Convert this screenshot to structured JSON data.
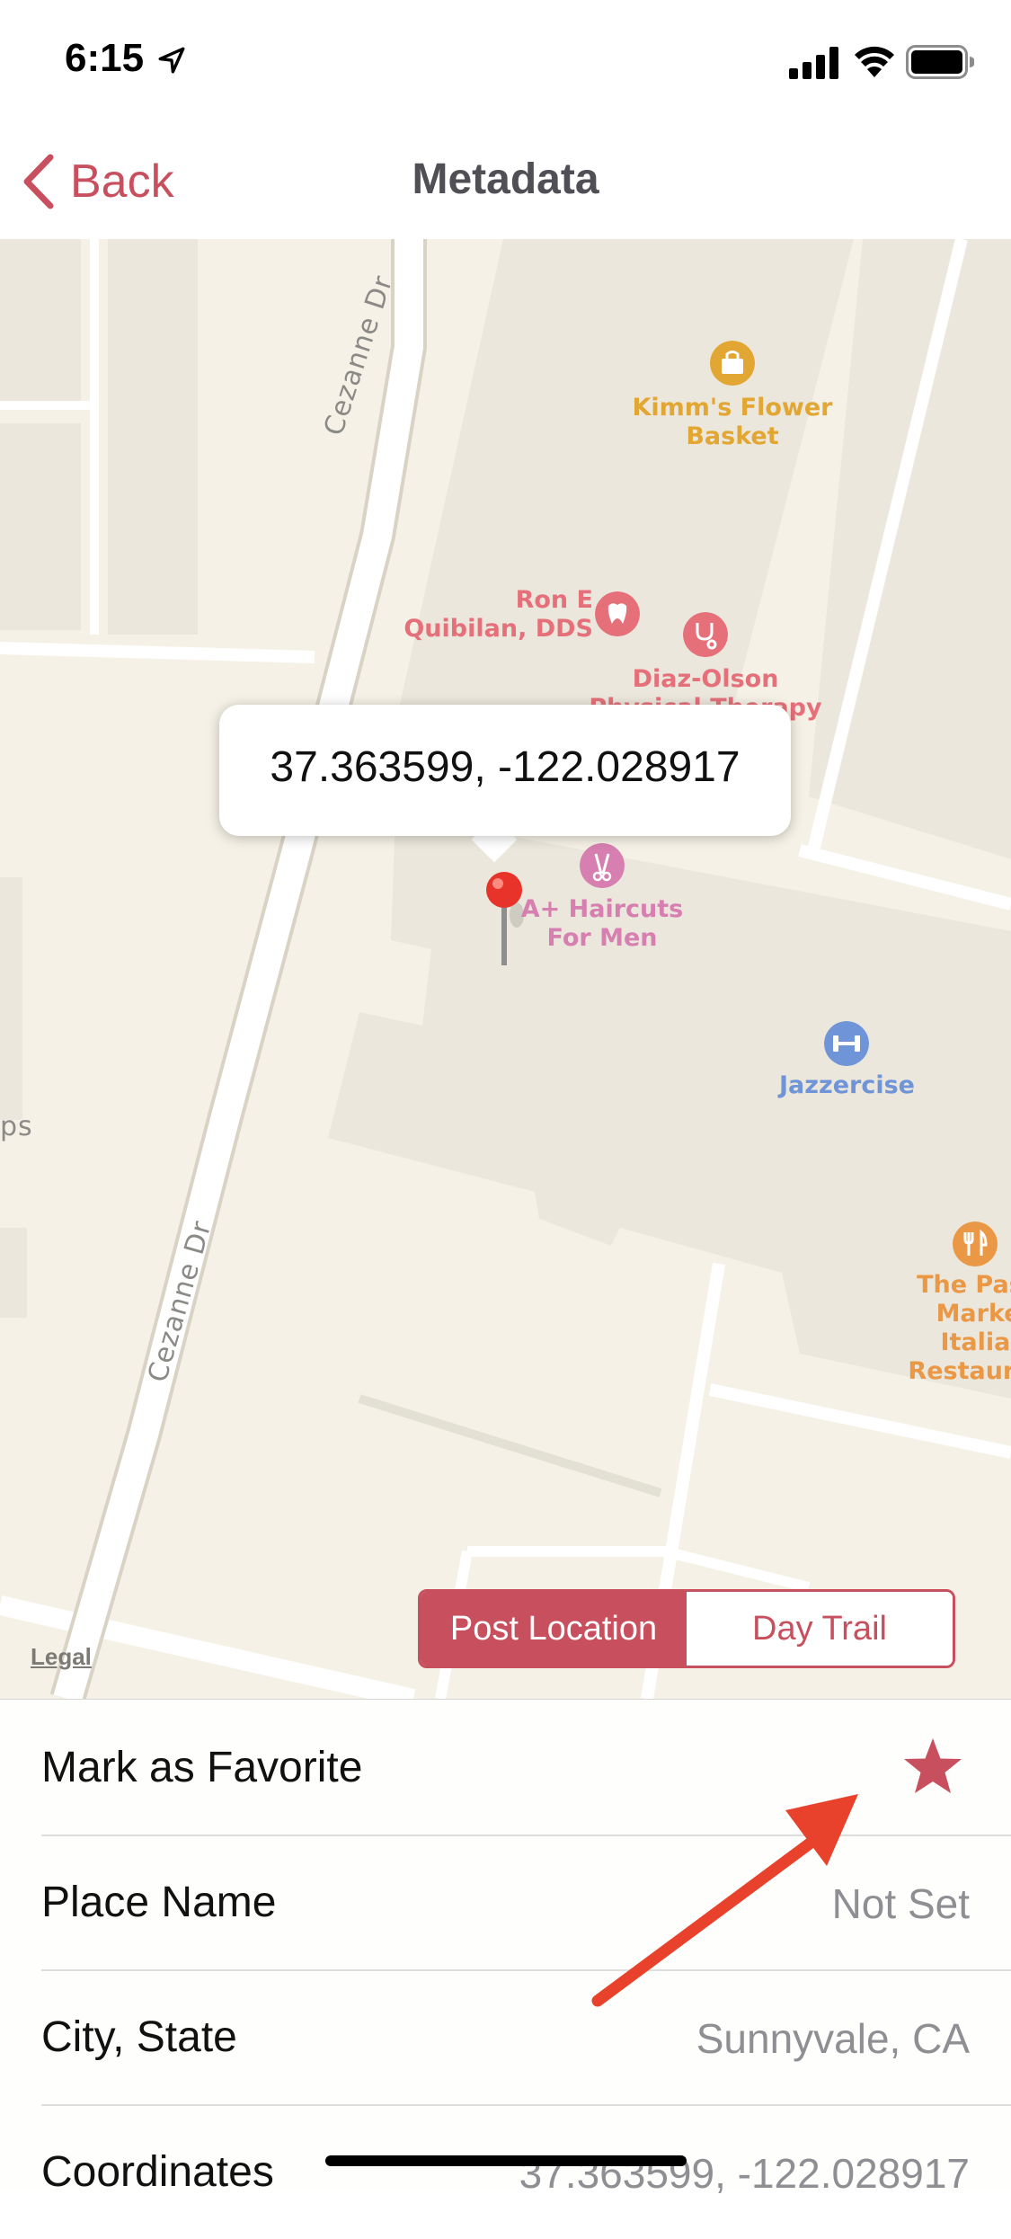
{
  "status_bar": {
    "time": "6:15"
  },
  "nav": {
    "back_label": "Back",
    "title": "Metadata"
  },
  "map": {
    "streets": [
      "Cezanne Dr",
      "Cezanne Dr"
    ],
    "pois": [
      {
        "name": "Kimm's Flower Basket",
        "icon": "shopping-bag-icon",
        "color": "#e2a632"
      },
      {
        "name": "Ron E Quibilan, DDS",
        "icon": "tooth-icon",
        "color": "#e5707a"
      },
      {
        "name": "Diaz-Olson Physical Therapy and Sports",
        "icon": "stethoscope-icon",
        "color": "#e5707a"
      },
      {
        "name": "A+ Haircuts For Men",
        "icon": "scissors-icon",
        "color": "#d67fb0"
      },
      {
        "name": "Jazzercise",
        "icon": "dumbbell-icon",
        "color": "#7094d8"
      },
      {
        "name": "The Pasta Market Italian Restaurant",
        "icon": "fork-knife-icon",
        "color": "#ea9845"
      }
    ],
    "partial_label": "ps",
    "callout_coordinates": "37.363599, -122.028917",
    "legal": "Legal"
  },
  "segmented": {
    "options": [
      "Post Location",
      "Day Trail"
    ],
    "selected": "Post Location"
  },
  "rows": [
    {
      "label": "Mark as Favorite",
      "value": ""
    },
    {
      "label": "Place Name",
      "value": "Not Set"
    },
    {
      "label": "City, State",
      "value": "Sunnyvale, CA"
    },
    {
      "label": "Coordinates",
      "value": "37.363599, -122.028917"
    }
  ],
  "colors": {
    "accent": "#c8505e",
    "annotation_arrow": "#e8412c",
    "map_bg": "#f5f1e6"
  }
}
